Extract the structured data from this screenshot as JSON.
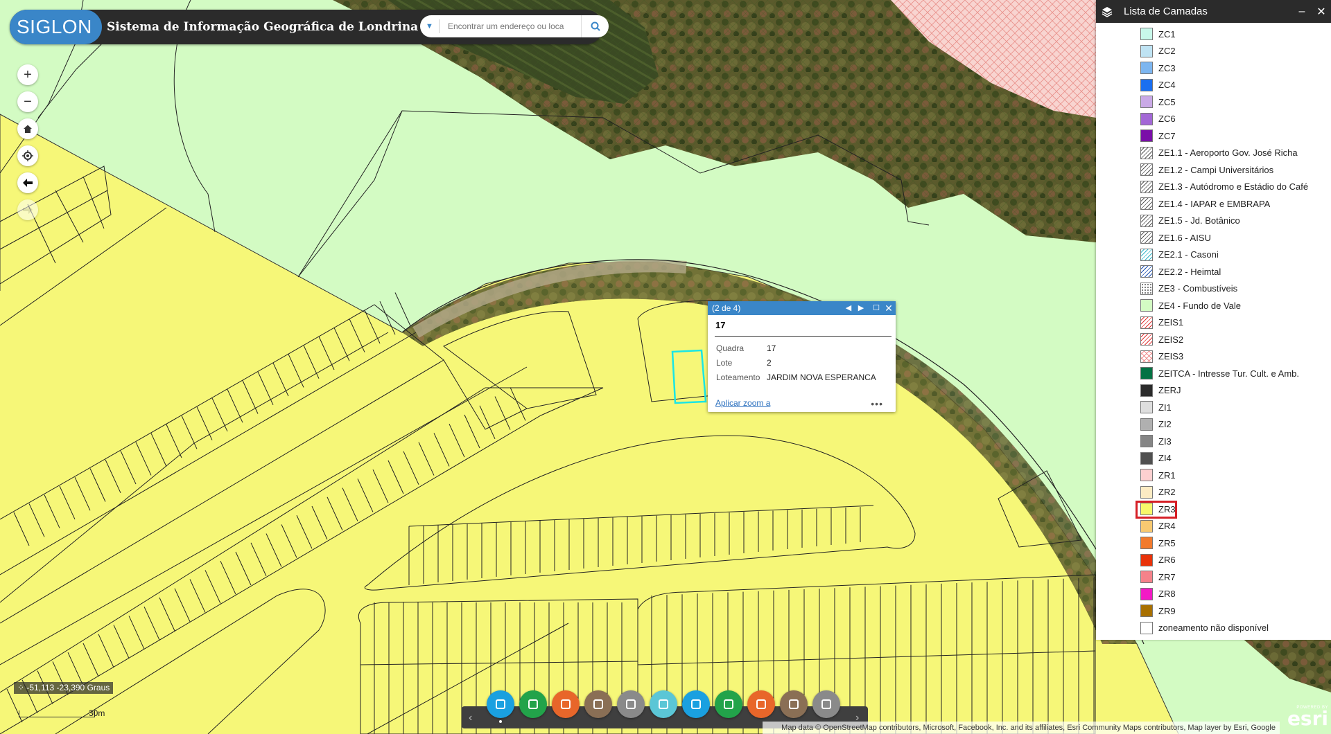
{
  "header": {
    "logo_text": "SIGLON",
    "title": "Sistema de Informação Geográfica de Londrina",
    "search_placeholder": "Encontrar um endereço ou loca"
  },
  "layer_panel": {
    "title": "Lista de Camadas",
    "highlighted": "ZR3",
    "items": [
      {
        "label": "ZC1",
        "color": "#c8f8ea"
      },
      {
        "label": "ZC2",
        "color": "#bfe3f3"
      },
      {
        "label": "ZC3",
        "color": "#7db6f0"
      },
      {
        "label": "ZC4",
        "color": "#1b6ff0"
      },
      {
        "label": "ZC5",
        "color": "#c9a9e6"
      },
      {
        "label": "ZC6",
        "color": "#a368d6"
      },
      {
        "label": "ZC7",
        "color": "#7a0fa8"
      },
      {
        "label": "ZE1.1 - Aeroporto Gov. José Richa",
        "color": "hatch-black"
      },
      {
        "label": "ZE1.2 - Campi Universitários",
        "color": "hatch-black"
      },
      {
        "label": "ZE1.3 - Autódromo e Estádio do Café",
        "color": "hatch-black"
      },
      {
        "label": "ZE1.4 - IAPAR e EMBRAPA",
        "color": "hatch-black"
      },
      {
        "label": "ZE1.5 - Jd. Botânico",
        "color": "hatch-black"
      },
      {
        "label": "ZE1.6 - AISU",
        "color": "hatch-black"
      },
      {
        "label": "ZE2.1 - Casoni",
        "color": "hatch-cyan"
      },
      {
        "label": "ZE2.2 - Heimtal",
        "color": "hatch-blue"
      },
      {
        "label": "ZE3 - Combustíveis",
        "color": "dots"
      },
      {
        "label": "ZE4 - Fundo de Vale",
        "color": "#d3fbc3"
      },
      {
        "label": "ZEIS1",
        "color": "hatch-red"
      },
      {
        "label": "ZEIS2",
        "color": "hatch-red"
      },
      {
        "label": "ZEIS3",
        "color": "cross-red"
      },
      {
        "label": "ZEITCA - Intresse Tur. Cult. e Amb.",
        "color": "#047244"
      },
      {
        "label": "ZERJ",
        "color": "#2b2b2b"
      },
      {
        "label": "ZI1",
        "color": "#dedede"
      },
      {
        "label": "ZI2",
        "color": "#b0b0b0"
      },
      {
        "label": "ZI3",
        "color": "#858585"
      },
      {
        "label": "ZI4",
        "color": "#505050"
      },
      {
        "label": "ZR1",
        "color": "#fcd0d0"
      },
      {
        "label": "ZR2",
        "color": "#fcebc3"
      },
      {
        "label": "ZR3",
        "color": "#f8f86a"
      },
      {
        "label": "ZR4",
        "color": "#f8c971"
      },
      {
        "label": "ZR5",
        "color": "#f27a2d"
      },
      {
        "label": "ZR6",
        "color": "#e8320a"
      },
      {
        "label": "ZR7",
        "color": "#f5828a"
      },
      {
        "label": "ZR8",
        "color": "#f21ac5"
      },
      {
        "label": "ZR9",
        "color": "#a87000"
      },
      {
        "label": "zoneamento não disponível",
        "color": "#ffffff"
      }
    ]
  },
  "popup": {
    "counter": "(2 de 4)",
    "title": "17",
    "rows": [
      {
        "key": "Quadra",
        "value": "17"
      },
      {
        "key": "Lote",
        "value": "2"
      },
      {
        "key": "Loteamento",
        "value": "JARDIM NOVA ESPERANCA"
      }
    ],
    "zoom_link": "Aplicar zoom a",
    "more": "•••"
  },
  "status": {
    "coordinates": "-51,113 -23,390 Graus",
    "scale": "30m"
  },
  "attribution": "Map data © OpenStreetMap contributors, Microsoft, Facebook, Inc. and its affiliates, Esri Community Maps contributors, Map layer by Esri, Google",
  "esri": {
    "powered": "POWERED BY",
    "name": "esri"
  },
  "toolbar": [
    {
      "name": "layers-tool",
      "color": "#1aa0e0"
    },
    {
      "name": "measure-tool",
      "color": "#22a34a"
    },
    {
      "name": "basemap-tool",
      "color": "#e8662a"
    },
    {
      "name": "filter-tool",
      "color": "#8a6f55"
    },
    {
      "name": "geolocate-tool",
      "color": "#8a8a8a"
    },
    {
      "name": "swipe-tool",
      "color": "#5bc6d6"
    },
    {
      "name": "xyz-tool",
      "color": "#1aa0e0"
    },
    {
      "name": "share-tool",
      "color": "#22a34a"
    },
    {
      "name": "print-tool",
      "color": "#e8662a"
    },
    {
      "name": "info-tool",
      "color": "#8a6f55"
    },
    {
      "name": "query-tool",
      "color": "#8a8a8a"
    }
  ]
}
